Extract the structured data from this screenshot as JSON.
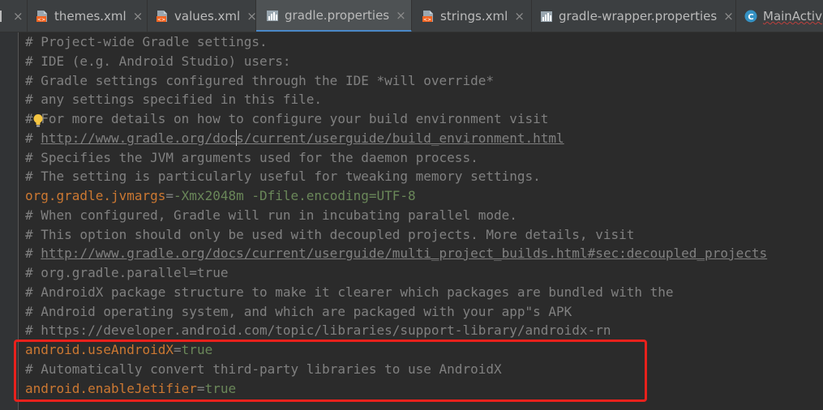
{
  "tabs": [
    {
      "label": "",
      "icon": "truncated-file-icon",
      "closable": true,
      "active": false
    },
    {
      "label": "themes.xml",
      "icon": "xml-file-icon",
      "closable": true,
      "active": false
    },
    {
      "label": "values.xml",
      "icon": "xml-file-icon",
      "closable": true,
      "active": false
    },
    {
      "label": "gradle.properties",
      "icon": "gradle-properties-icon",
      "closable": true,
      "active": true
    },
    {
      "label": "strings.xml",
      "icon": "xml-file-icon",
      "closable": true,
      "active": false
    },
    {
      "label": "gradle-wrapper.properties",
      "icon": "gradle-properties-icon",
      "closable": true,
      "active": false
    },
    {
      "label": "MainActiv",
      "icon": "kotlin-class-icon",
      "closable": false,
      "active": false
    }
  ],
  "tab_close_glyph": "×",
  "editor": {
    "lines": [
      {
        "type": "comment",
        "text": "# Project-wide Gradle settings."
      },
      {
        "type": "comment",
        "text": "# IDE (e.g. Android Studio) users:"
      },
      {
        "type": "comment",
        "text": "# Gradle settings configured through the IDE *will override*"
      },
      {
        "type": "comment",
        "text": "# any settings specified in this file."
      },
      {
        "type": "comment",
        "text": "# For more details on how to configure your build environment visit"
      },
      {
        "type": "link",
        "prefix": "# ",
        "text": "http://www.gradle.org/docs/current/userguide/build_environment.html"
      },
      {
        "type": "comment",
        "text": "# Specifies the JVM arguments used for the daemon process."
      },
      {
        "type": "comment",
        "text": "# The setting is particularly useful for tweaking memory settings."
      },
      {
        "type": "property",
        "key": "org.gradle.jvmargs",
        "sep": "=",
        "value": "-Xmx2048m -Dfile.encoding=UTF-8"
      },
      {
        "type": "comment",
        "text": "# When configured, Gradle will run in incubating parallel mode."
      },
      {
        "type": "comment",
        "text": "# This option should only be used with decoupled projects. More details, visit"
      },
      {
        "type": "link",
        "prefix": "# ",
        "text": "http://www.gradle.org/docs/current/userguide/multi_project_builds.html#sec:decoupled_projects"
      },
      {
        "type": "comment",
        "text": "# org.gradle.parallel=true"
      },
      {
        "type": "comment",
        "text": "# AndroidX package structure to make it clearer which packages are bundled with the"
      },
      {
        "type": "comment",
        "text": "# Android operating system, and which are packaged with your app\"s APK"
      },
      {
        "type": "comment",
        "text": "# https://developer.android.com/topic/libraries/support-library/androidx-rn"
      },
      {
        "type": "property",
        "key": "android.useAndroidX",
        "sep": "=",
        "value": "true"
      },
      {
        "type": "comment",
        "text": "# Automatically convert third-party libraries to use AndroidX"
      },
      {
        "type": "property",
        "key": "android.enableJetifier",
        "sep": "=",
        "value": "true"
      }
    ]
  },
  "colors": {
    "comment": "#808080",
    "property_key": "#cc7832",
    "property_value": "#6a8759",
    "highlight_box": "#e8211c",
    "active_tab_underline": "#4a88c7"
  }
}
